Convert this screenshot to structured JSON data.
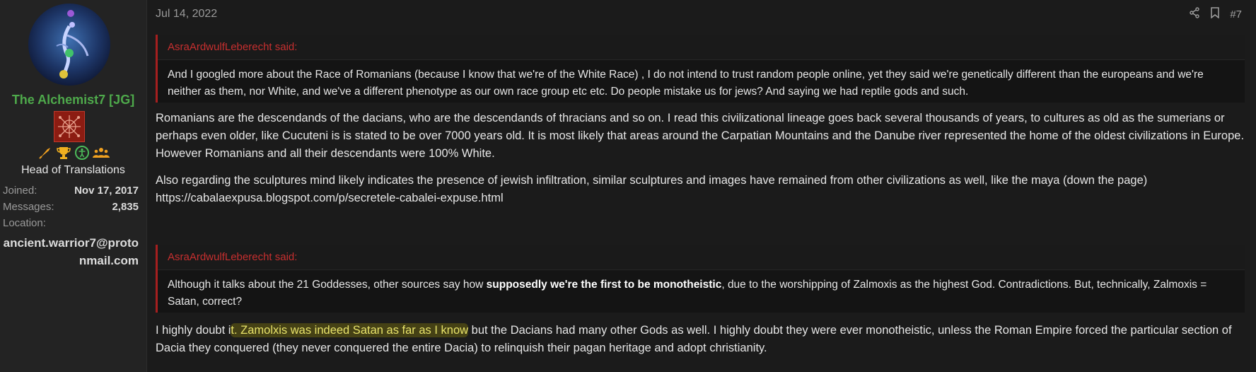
{
  "user": {
    "name": "The Alchemist7 [JG]",
    "title": "Head of Translations",
    "stats": [
      {
        "label": "Joined:",
        "value": "Nov 17, 2017"
      },
      {
        "label": "Messages:",
        "value": "2,835"
      },
      {
        "label": "Location:",
        "value": ""
      }
    ],
    "location": "ancient.warrior7@protonmail.com",
    "awards": [
      "quill-award-icon",
      "trophy-award-icon",
      "accessibility-award-icon",
      "group-award-icon"
    ],
    "colors": {
      "name": "#4ea94b",
      "badge": "#8c1c12"
    }
  },
  "post": {
    "date": "Jul 14, 2022",
    "number": "#7",
    "quote1": {
      "author": "AsraArdwulfLeberecht said:",
      "text": "And I googled more about the Race of Romanians (because I know that we're of the White Race) , I do not intend to trust random people online, yet they said we're genetically different than the europeans and we're neither as them, nor White, and we've a different phenotype as our own race group etc etc. Do people mistake us for jews? And saying we had reptile gods and such."
    },
    "para1": "Romanians are the descendands of the dacians, who are the descendands of thracians and so on. I read this civilizational lineage goes back several thousands of years, to cultures as old as the sumerians or perhaps even older, like Cucuteni is is stated to be over 7000 years old. It is most likely that areas around the Carpatian Mountains and the Danube river represented the home of the oldest civilizations in Europe. However Romanians and all their descendants were 100% White.",
    "para2": "Also regarding the sculptures mind likely indicates the presence of jewish infiltration, similar sculptures and images have remained from other civilizations as well, like the maya (down the page)",
    "link": "https://cabalaexpusa.blogspot.com/p/secretele-cabalei-expuse.html",
    "quote2": {
      "author": "AsraArdwulfLeberecht said:",
      "text_before": "Although it talks about the 21 Goddesses, other sources say how ",
      "text_bold": "supposedly we're the first to be monotheistic",
      "text_after": ", due to the worshipping of Zalmoxis as the highest God. Contradictions. But, technically, Zalmoxis = Satan, correct?"
    },
    "para3": {
      "before": "I highly doubt i",
      "highlight": "t. Zamolxis was indeed Satan as far as I know",
      "after": " but the Dacians had many other Gods as well. I highly doubt they were ever monotheistic, unless the Roman Empire forced the particular section of Dacia they conquered (they never conquered the entire Dacia) to relinquish their pagan heritage and adopt christianity."
    },
    "colors": {
      "quote_accent": "#a51f1f",
      "highlight": "#e8e36a"
    }
  }
}
